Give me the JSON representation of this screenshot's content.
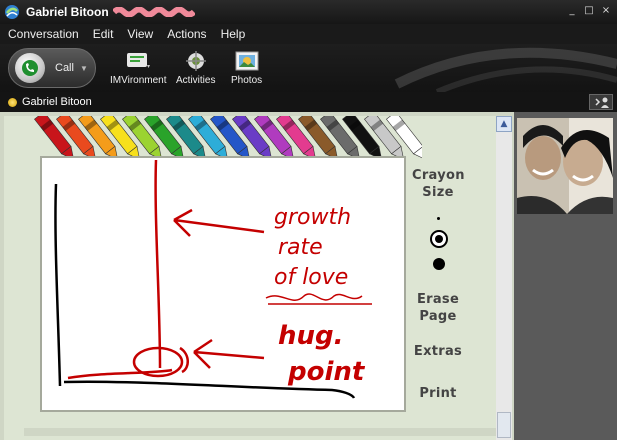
{
  "window": {
    "title": "Gabriel Bitoon",
    "controls": {
      "minimize": "_",
      "maximize": "□",
      "close": "×"
    }
  },
  "menu": [
    "Conversation",
    "Edit",
    "View",
    "Actions",
    "Help"
  ],
  "toolbar": {
    "call_label": "Call",
    "tools": [
      {
        "label": "IMVironment",
        "icon": "imvironment-icon"
      },
      {
        "label": "Activities",
        "icon": "activities-icon"
      },
      {
        "label": "Photos",
        "icon": "photos-icon"
      }
    ]
  },
  "contact": {
    "name": "Gabriel Bitoon",
    "status_color": "#f2c200"
  },
  "crayon_panel": {
    "crayon_colors": [
      "#c8151b",
      "#e94a1e",
      "#f49c1a",
      "#f7e01c",
      "#9bd331",
      "#2aa32a",
      "#1c8a8a",
      "#2dadd8",
      "#2456c8",
      "#6a3cc6",
      "#b03bbf",
      "#e33b8f",
      "#8a5a2a",
      "#6b6b6b",
      "#111111",
      "#c8c8c8",
      "#ffffff"
    ],
    "labels": {
      "crayon_size": "Crayon\nSize",
      "erase_page": "Erase\nPage",
      "extras": "Extras",
      "print": "Print"
    },
    "selected_size": "medium"
  },
  "drawing": {
    "annotations": [
      "growth rate of love",
      "hug point"
    ],
    "ink_colors": {
      "red": "#c40000",
      "black": "#000000"
    }
  }
}
